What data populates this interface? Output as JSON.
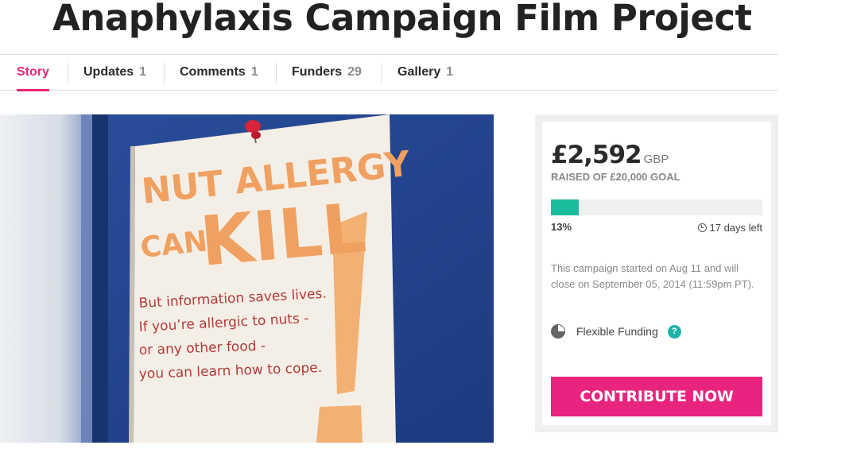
{
  "page": {
    "title": "Anaphylaxis Campaign Film Project"
  },
  "tabs": [
    {
      "label": "Story",
      "count": ""
    },
    {
      "label": "Updates",
      "count": "1"
    },
    {
      "label": "Comments",
      "count": "1"
    },
    {
      "label": "Funders",
      "count": "29"
    },
    {
      "label": "Gallery",
      "count": "1"
    }
  ],
  "media": {
    "poster_line1": "NUT ALLERGY",
    "poster_line2a": "CAN",
    "poster_line2b": "KILL",
    "poster_lines": [
      "But information saves lives.",
      "If you’re allergic to nuts -",
      "or any other food -",
      "you can learn how to cope."
    ]
  },
  "campaign": {
    "amount": "£2,592",
    "currency": "GBP",
    "goal_text": "RAISED OF £20,000 GOAL",
    "percent_text": "13%",
    "progress_fraction": 0.13,
    "days_left": "17 days left",
    "description": "This campaign started on Aug 11 and will close on September 05, 2014 (11:59pm PT).",
    "funding_type": "Flexible Funding",
    "help_symbol": "?",
    "cta_label": "CONTRIBUTE NOW"
  },
  "colors": {
    "accent": "#e8247e",
    "progress": "#1abc9c",
    "help": "#1fb4a8"
  },
  "icons": {
    "days_left": "clock-icon",
    "funding": "pie-chart-icon",
    "help": "question-icon"
  }
}
